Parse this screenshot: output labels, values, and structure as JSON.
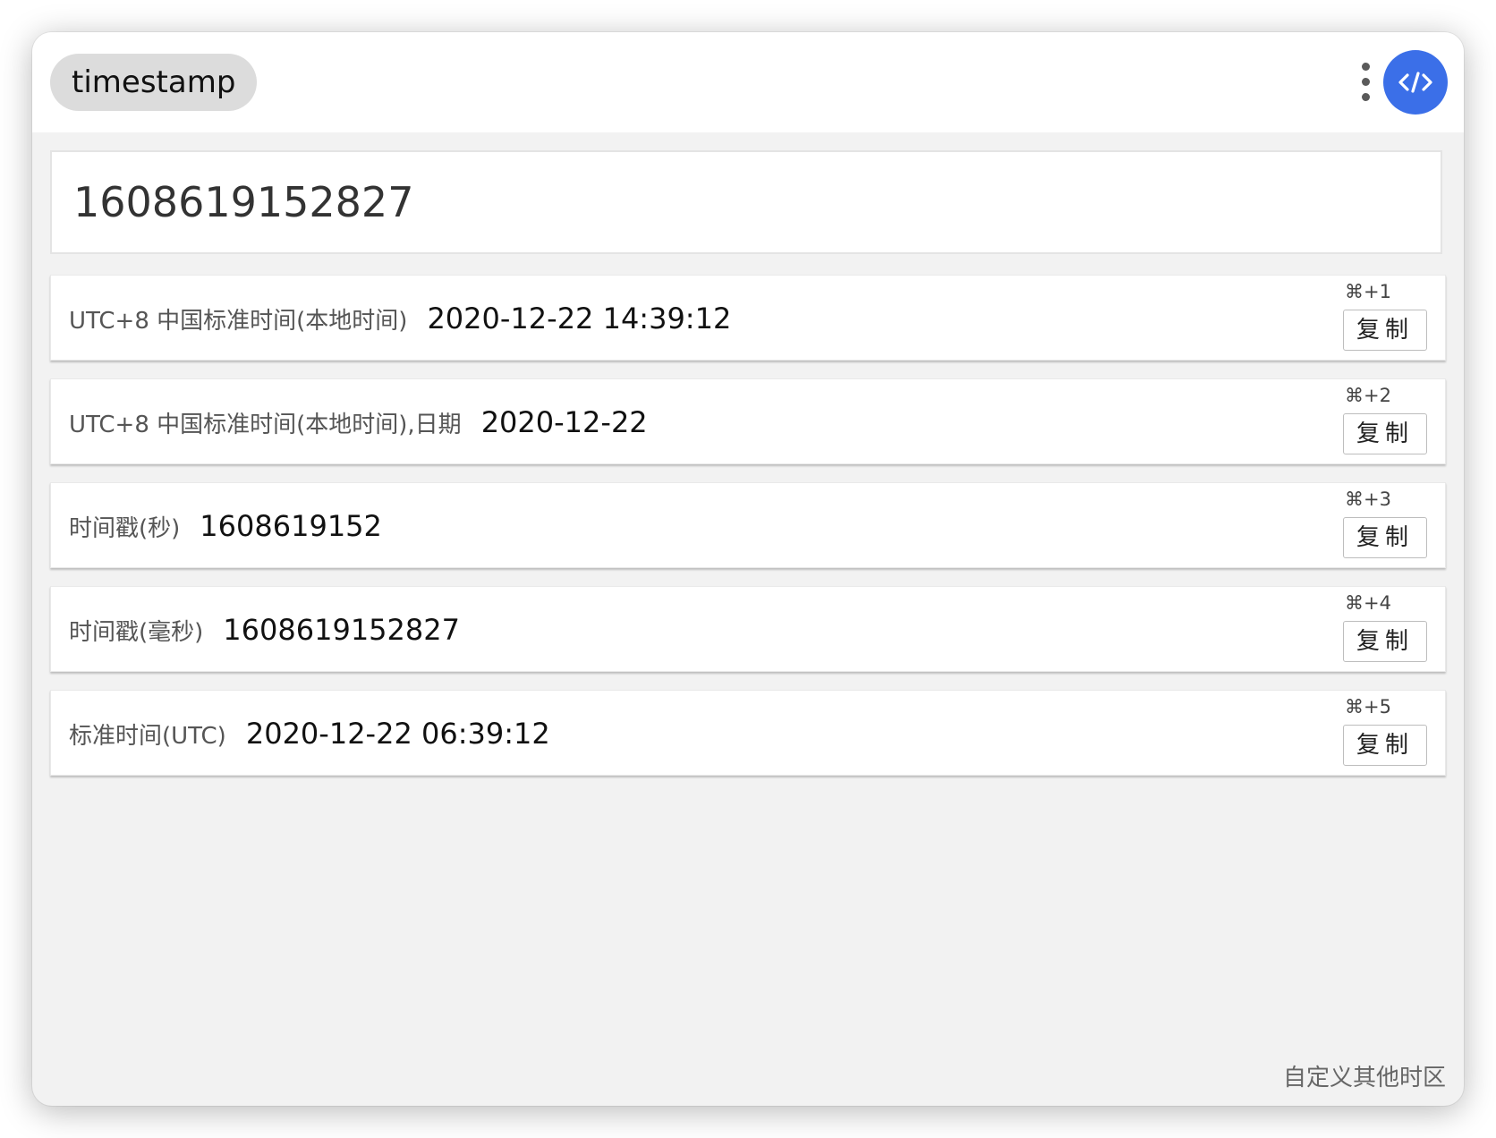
{
  "header": {
    "keyword": "timestamp",
    "more_icon": "more-vertical-icon",
    "logo_icon": "code-icon",
    "logo_color": "#3b6fe8"
  },
  "input": {
    "value": "1608619152827"
  },
  "results": [
    {
      "label": "UTC+8 中国标准时间(本地时间)",
      "value": "2020-12-22 14:39:12",
      "shortcut": "⌘+1",
      "copy": "复制"
    },
    {
      "label": "UTC+8 中国标准时间(本地时间),日期",
      "value": "2020-12-22",
      "shortcut": "⌘+2",
      "copy": "复制"
    },
    {
      "label": "时间戳(秒)",
      "value": "1608619152",
      "shortcut": "⌘+3",
      "copy": "复制"
    },
    {
      "label": "时间戳(毫秒)",
      "value": "1608619152827",
      "shortcut": "⌘+4",
      "copy": "复制"
    },
    {
      "label": "标准时间(UTC)",
      "value": "2020-12-22 06:39:12",
      "shortcut": "⌘+5",
      "copy": "复制"
    }
  ],
  "footer": {
    "custom_timezone": "自定义其他时区"
  }
}
